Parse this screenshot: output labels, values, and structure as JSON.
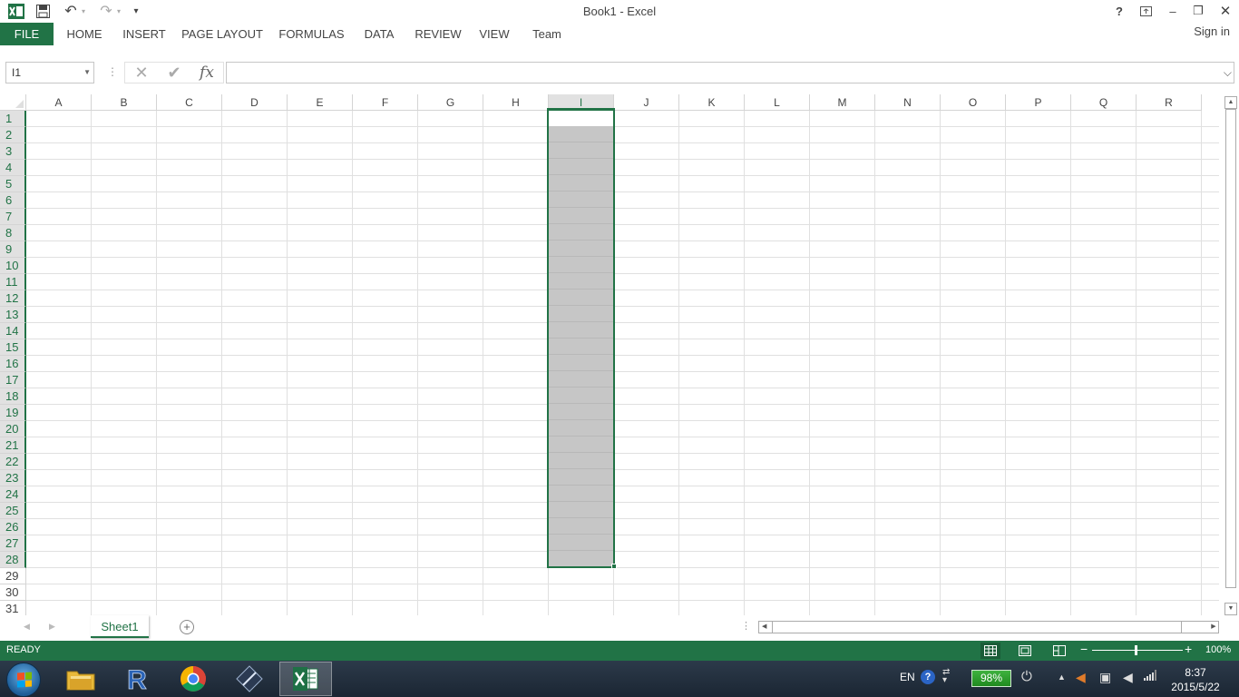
{
  "window": {
    "title": "Book1 - Excel",
    "help": "?",
    "minimize": "–",
    "restore": "❐",
    "close": "✕",
    "ribbon_display": "⇱"
  },
  "qat": {
    "undo": "↶",
    "redo": "↷",
    "customize": "▾"
  },
  "ribbon": {
    "tabs": [
      "FILE",
      "HOME",
      "INSERT",
      "PAGE LAYOUT",
      "FORMULAS",
      "DATA",
      "REVIEW",
      "VIEW",
      "Team"
    ],
    "signin": "Sign in"
  },
  "formula_bar": {
    "name_box": "I1",
    "cancel": "✕",
    "enter": "✔",
    "fx": "fx",
    "value": ""
  },
  "grid": {
    "columns": [
      "A",
      "B",
      "C",
      "D",
      "E",
      "F",
      "G",
      "H",
      "I",
      "J",
      "K",
      "L",
      "M",
      "N",
      "O",
      "P",
      "Q",
      "R"
    ],
    "rows": [
      "1",
      "2",
      "3",
      "4",
      "5",
      "6",
      "7",
      "8",
      "9",
      "10",
      "11",
      "12",
      "13",
      "14",
      "15",
      "16",
      "17",
      "18",
      "19",
      "20",
      "21",
      "22",
      "23",
      "24",
      "25",
      "26",
      "27",
      "28",
      "29",
      "30",
      "31"
    ],
    "selected_column": "I",
    "selected_rows": "1-28",
    "accent": "#217346"
  },
  "sheets": {
    "tabs": [
      "Sheet1"
    ],
    "active": "Sheet1",
    "add": "+"
  },
  "status": {
    "text": "READY",
    "zoom": "100%",
    "minus": "−",
    "plus": "+"
  },
  "taskbar": {
    "apps": [
      "file-explorer",
      "r",
      "chrome",
      "media-player",
      "excel"
    ],
    "lang": "EN",
    "help": "?",
    "battery": "98%",
    "time": "8:37",
    "date": "2015/5/22"
  }
}
